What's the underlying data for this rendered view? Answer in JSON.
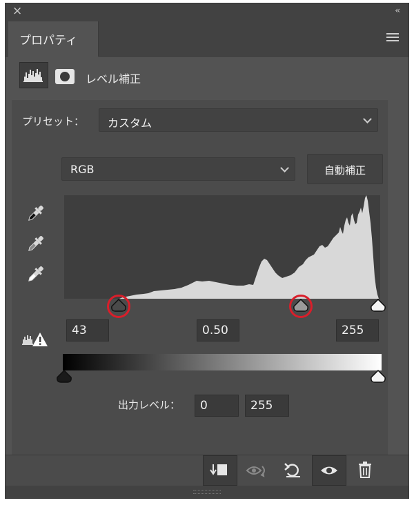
{
  "window": {
    "close_glyph": "×",
    "collapse_glyph": "‹‹"
  },
  "panel": {
    "tab_label": "プロパティ",
    "menu_icon": "hamburger-menu-icon"
  },
  "adjustment": {
    "title": "レベル補正",
    "icons": [
      "histogram-icon",
      "layer-mask-icon"
    ]
  },
  "preset": {
    "label": "プリセット：",
    "value": "カスタム"
  },
  "channel": {
    "value": "RGB"
  },
  "auto_button": {
    "label": "自動補正"
  },
  "eyedroppers": [
    "black-point-eyedropper-icon",
    "gray-point-eyedropper-icon",
    "white-point-eyedropper-icon"
  ],
  "input_levels": {
    "shadow": "43",
    "midtone": "0.50",
    "highlight": "255"
  },
  "output_levels": {
    "label": "出力レベル：",
    "low": "0",
    "high": "255"
  },
  "highlighted_sliders": [
    "input-shadow-slider",
    "input-midtone-slider"
  ],
  "colors": {
    "panel_bg": "#535353",
    "dark_bg": "#424242",
    "histogram_bg": "#3e3e3e",
    "histogram_fill": "#d8d8d8",
    "highlight_ring": "#d91e2a"
  },
  "footer_buttons": [
    "clip-to-layer-icon",
    "view-previous-state-icon",
    "reset-icon",
    "visibility-eye-icon",
    "trash-icon"
  ]
}
